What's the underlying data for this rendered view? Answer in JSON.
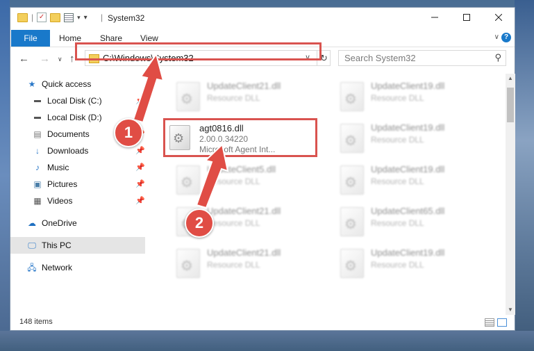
{
  "window": {
    "title": "System32"
  },
  "ribbon": {
    "tabs": [
      "File",
      "Home",
      "Share",
      "View"
    ]
  },
  "nav": {
    "address_path": "C:\\Windows\\System32",
    "search_placeholder": "Search System32"
  },
  "sidebar": {
    "items": [
      {
        "label": "Quick access",
        "icon": "star-icon",
        "pinned": false
      },
      {
        "label": "Local Disk (C:)",
        "icon": "drive-icon",
        "pinned": true
      },
      {
        "label": "Local Disk (D:)",
        "icon": "drive-icon",
        "pinned": true
      },
      {
        "label": "Documents",
        "icon": "documents-icon",
        "pinned": true
      },
      {
        "label": "Downloads",
        "icon": "download-icon",
        "pinned": true
      },
      {
        "label": "Music",
        "icon": "music-icon",
        "pinned": true
      },
      {
        "label": "Pictures",
        "icon": "pictures-icon",
        "pinned": true
      },
      {
        "label": "Videos",
        "icon": "videos-icon",
        "pinned": true
      },
      {
        "label": "OneDrive",
        "icon": "cloud-icon",
        "pinned": false
      },
      {
        "label": "This PC",
        "icon": "computer-icon",
        "pinned": false,
        "selected": true
      },
      {
        "label": "Network",
        "icon": "network-icon",
        "pinned": false
      }
    ]
  },
  "files": {
    "highlighted": {
      "name": "agt0816.dll",
      "version": "2.00.0.34220",
      "description": "Microsoft Agent Int..."
    },
    "tiles": [
      {
        "name": "UpdateClient21.dll",
        "type": "Resource DLL"
      },
      {
        "name": "UpdateClient19.dll",
        "type": "Resource DLL"
      },
      {
        "name": "UpdateClient19.dll",
        "type": "Resource DLL"
      },
      {
        "name": "UpdateClient5.dll",
        "type": "Resource DLL"
      },
      {
        "name": "UpdateClient19.dll",
        "type": "Resource DLL"
      },
      {
        "name": "UpdateClient21.dll",
        "type": "Resource DLL"
      },
      {
        "name": "UpdateClient65.dll",
        "type": "Resource DLL"
      },
      {
        "name": "UpdateClient21.dll",
        "type": "Resource DLL"
      },
      {
        "name": "UpdateClient19.dll",
        "type": "Resource DLL"
      }
    ]
  },
  "status": {
    "item_count": "148 items"
  },
  "annotations": {
    "step1": "1",
    "step2": "2"
  },
  "colors": {
    "accent": "#1979ca",
    "highlight": "#d9534f"
  }
}
